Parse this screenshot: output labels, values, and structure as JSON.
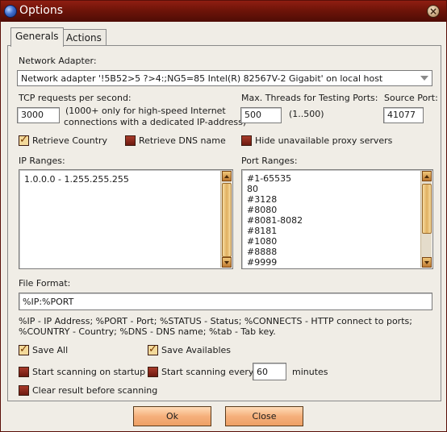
{
  "window": {
    "title": "Options",
    "app_icon": "globe-icon",
    "close_icon": "close-icon"
  },
  "tabs": [
    {
      "label": "Generals",
      "active": true
    },
    {
      "label": "Actions",
      "active": false
    }
  ],
  "network": {
    "label": "Network Adapter:",
    "value": "Network adapter '!5B52>5 ?>4:;NG5=85 Intel(R) 82567V-2 Gigabit' on local host"
  },
  "tcp": {
    "label": "TCP requests per second:",
    "value": "3000",
    "note_line1": "(1000+ only for high-speed Internet",
    "note_line2": "connections with a dedicated IP-address)"
  },
  "threads": {
    "label": "Max. Threads for Testing Ports:",
    "value": "500",
    "range": "(1..500)"
  },
  "source_port": {
    "label": "Source Port:",
    "value": "41077"
  },
  "checks": {
    "retrieve_country": {
      "label": "Retrieve Country",
      "checked": true
    },
    "retrieve_dns": {
      "label": "Retrieve DNS name",
      "checked": false
    },
    "hide_unavailable": {
      "label": "Hide unavailable proxy servers",
      "checked": false
    },
    "save_all": {
      "label": "Save All",
      "checked": true
    },
    "save_availables": {
      "label": "Save Availables",
      "checked": true
    },
    "start_on_startup": {
      "label": "Start scanning on startup",
      "checked": false
    },
    "start_every": {
      "label": "Start scanning every",
      "checked": false
    },
    "clear_result": {
      "label": "Clear result before scanning",
      "checked": false
    }
  },
  "ip_ranges": {
    "label": "IP Ranges:",
    "items": [
      "1.0.0.0 - 1.255.255.255"
    ]
  },
  "port_ranges": {
    "label": "Port Ranges:",
    "items": [
      "#1-65535",
      "80",
      "#3128",
      "#8080",
      "#8081-8082",
      "#8181",
      "#1080",
      "#8888",
      "#9999"
    ]
  },
  "file_format": {
    "label": "File Format:",
    "value": "%IP:%PORT",
    "help_line1": "%IP - IP Address; %PORT - Port; %STATUS - Status; %CONNECTS - HTTP connect to ports;",
    "help_line2": "%COUNTRY - Country; %DNS - DNS name; %tab - Tab key."
  },
  "interval": {
    "value": "60",
    "unit": "minutes"
  },
  "buttons": {
    "ok": "Ok",
    "close": "Close"
  },
  "colors": {
    "titlebar": "#6f1409",
    "button": "#f5b07c",
    "checkbox_on": "#f3d99a",
    "checkbox_off": "#8c2a1c"
  }
}
